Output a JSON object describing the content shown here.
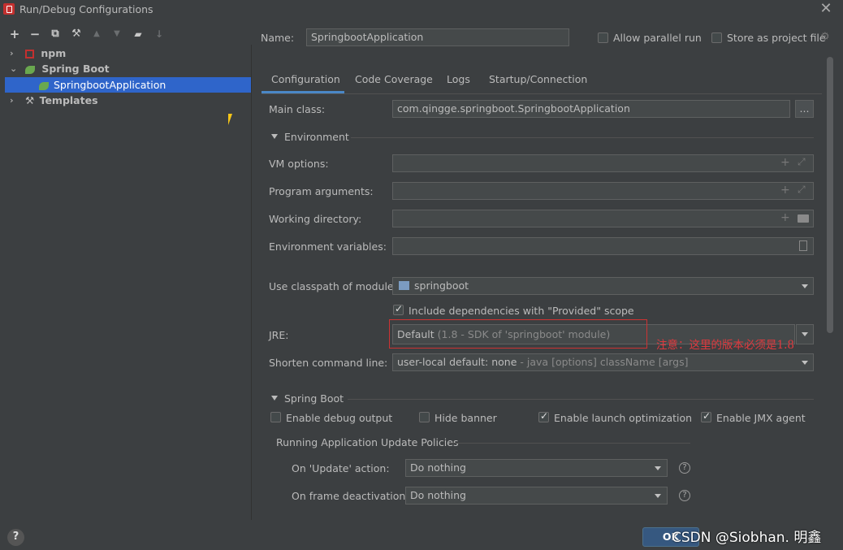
{
  "window": {
    "title": "Run/Debug Configurations"
  },
  "toolbar": {
    "add": "+",
    "remove": "−",
    "copy": "⧉",
    "edit": "🔧",
    "up": "▲",
    "down": "▼",
    "folder": "▰",
    "sort": "↓"
  },
  "tree": {
    "npm": "npm",
    "spring_boot": "Spring Boot",
    "selected_config": "SpringbootApplication",
    "templates": "Templates"
  },
  "header": {
    "name_label": "Name:",
    "name_value": "SpringbootApplication",
    "allow_parallel": "Allow parallel run",
    "store_project": "Store as project file"
  },
  "tabs": [
    "Configuration",
    "Code Coverage",
    "Logs",
    "Startup/Connection"
  ],
  "config": {
    "main_class_label": "Main class:",
    "main_class_value": "com.qingge.springboot.SpringbootApplication",
    "browse": "...",
    "environment_section": "Environment",
    "vm_options_label": "VM options:",
    "program_args_label": "Program arguments:",
    "working_dir_label": "Working directory:",
    "env_vars_label": "Environment variables:",
    "classpath_label": "Use classpath of module:",
    "classpath_value": "springboot",
    "include_deps": "Include dependencies with \"Provided\" scope",
    "jre_label": "JRE:",
    "jre_value": "Default",
    "jre_hint": "(1.8 - SDK of 'springboot' module)",
    "shorten_label": "Shorten command line:",
    "shorten_value": "user-local default: none",
    "shorten_hint": "- java [options] className [args]",
    "spring_boot_section": "Spring Boot",
    "debug_output": "Enable debug output",
    "hide_banner": "Hide banner",
    "launch_opt": "Enable launch optimization",
    "jmx_agent": "Enable JMX agent",
    "update_policies": "Running Application Update Policies",
    "on_update_label": "On 'Update' action:",
    "on_update_value": "Do nothing",
    "on_frame_label": "On frame deactivation:",
    "on_frame_value": "Do nothing"
  },
  "annotation": {
    "note": "注意：这里的版本必须是1.8"
  },
  "footer": {
    "help": "?",
    "ok": "OK",
    "watermark": "CSDN @Siobhan. 明鑫"
  }
}
